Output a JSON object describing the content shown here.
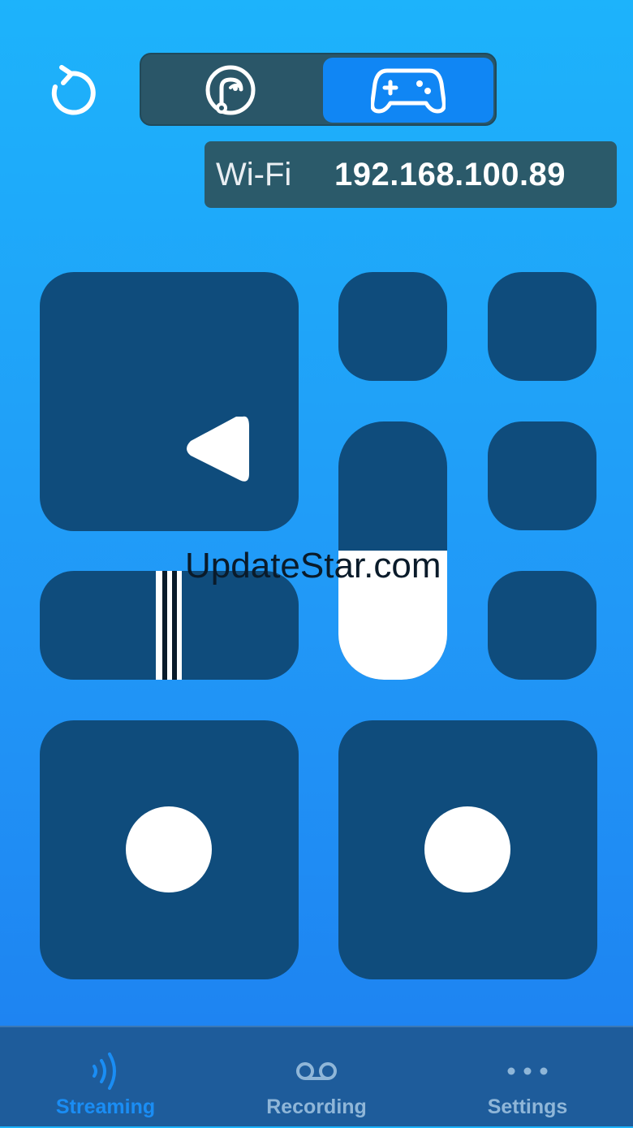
{
  "header": {
    "refresh_icon": "refresh-icon",
    "mode_selector": [
      {
        "icon": "touchpad-icon",
        "selected": false
      },
      {
        "icon": "gamepad-icon",
        "selected": true
      }
    ],
    "connection": {
      "label": "Wi-Fi",
      "ip": "192.168.100.89"
    }
  },
  "controls": {
    "pads": [
      "touch-pad",
      "button-a",
      "button-b",
      "button-c",
      "button-d",
      "slider-pad",
      "vertical-fader",
      "left-joystick",
      "right-joystick"
    ],
    "vertical_fader_level": 0.5
  },
  "watermark": "UpdateStar.com",
  "tabbar": {
    "tabs": [
      {
        "label": "Streaming",
        "icon": "streaming-icon",
        "active": true
      },
      {
        "label": "Recording",
        "icon": "voicemail-icon",
        "active": false
      },
      {
        "label": "Settings",
        "icon": "more-icon",
        "active": false
      }
    ],
    "active_color": "#1a8df4",
    "inactive_color": "#8fb6d8"
  }
}
